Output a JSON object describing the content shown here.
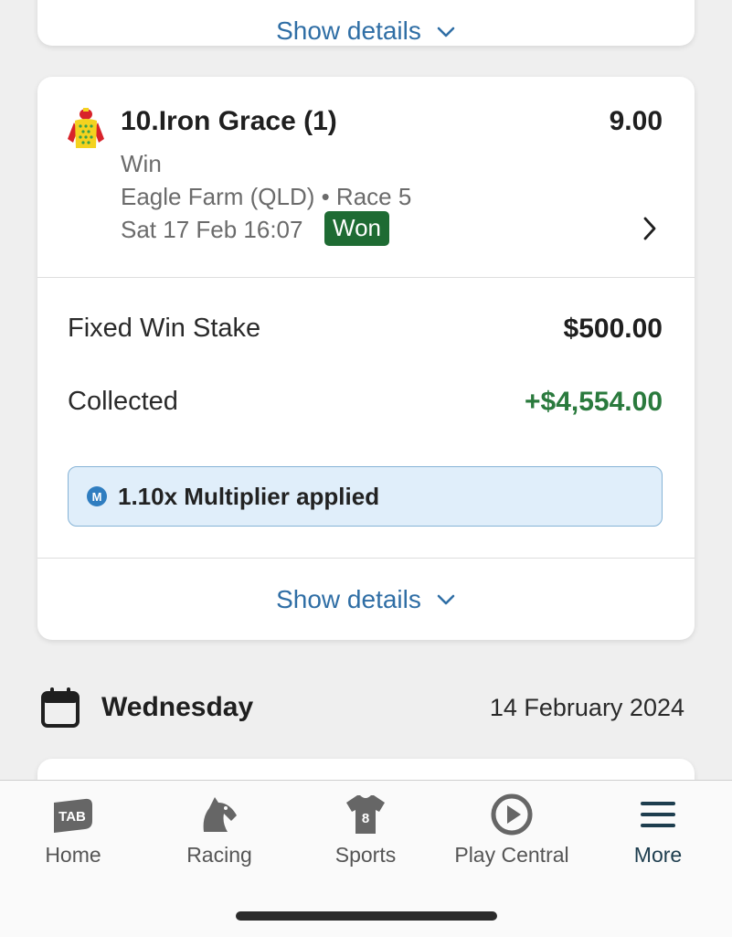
{
  "previous_card": {
    "show_details_label": "Show details"
  },
  "bet_card": {
    "runner_name": "10.Iron Grace (1)",
    "odds": "9.00",
    "bet_type": "Win",
    "venue": "Eagle Farm (QLD) • Race 5",
    "race_time": "Sat 17 Feb 16:07",
    "result_badge": "Won",
    "stake_label": "Fixed Win Stake",
    "stake_value": "$500.00",
    "collected_label": "Collected",
    "collected_value": "+$4,554.00",
    "multiplier_icon": "M",
    "multiplier_text": "1.10x Multiplier applied",
    "show_details_label": "Show details"
  },
  "day_header": {
    "day_name": "Wednesday",
    "date": "14 February 2024"
  },
  "bottom_nav": {
    "items": [
      {
        "label": "Home",
        "icon": "tab-logo-icon"
      },
      {
        "label": "Racing",
        "icon": "horse-icon"
      },
      {
        "label": "Sports",
        "icon": "jersey-icon",
        "icon_text": "8"
      },
      {
        "label": "Play Central",
        "icon": "play-icon"
      },
      {
        "label": "More",
        "icon": "hamburger-menu-icon"
      }
    ]
  },
  "colors": {
    "link_blue": "#2f6ea5",
    "won_green": "#1e6b33",
    "collected_green": "#2a7a3d",
    "multiplier_bg": "#e0eefa",
    "active_nav": "#1d3d4e"
  }
}
